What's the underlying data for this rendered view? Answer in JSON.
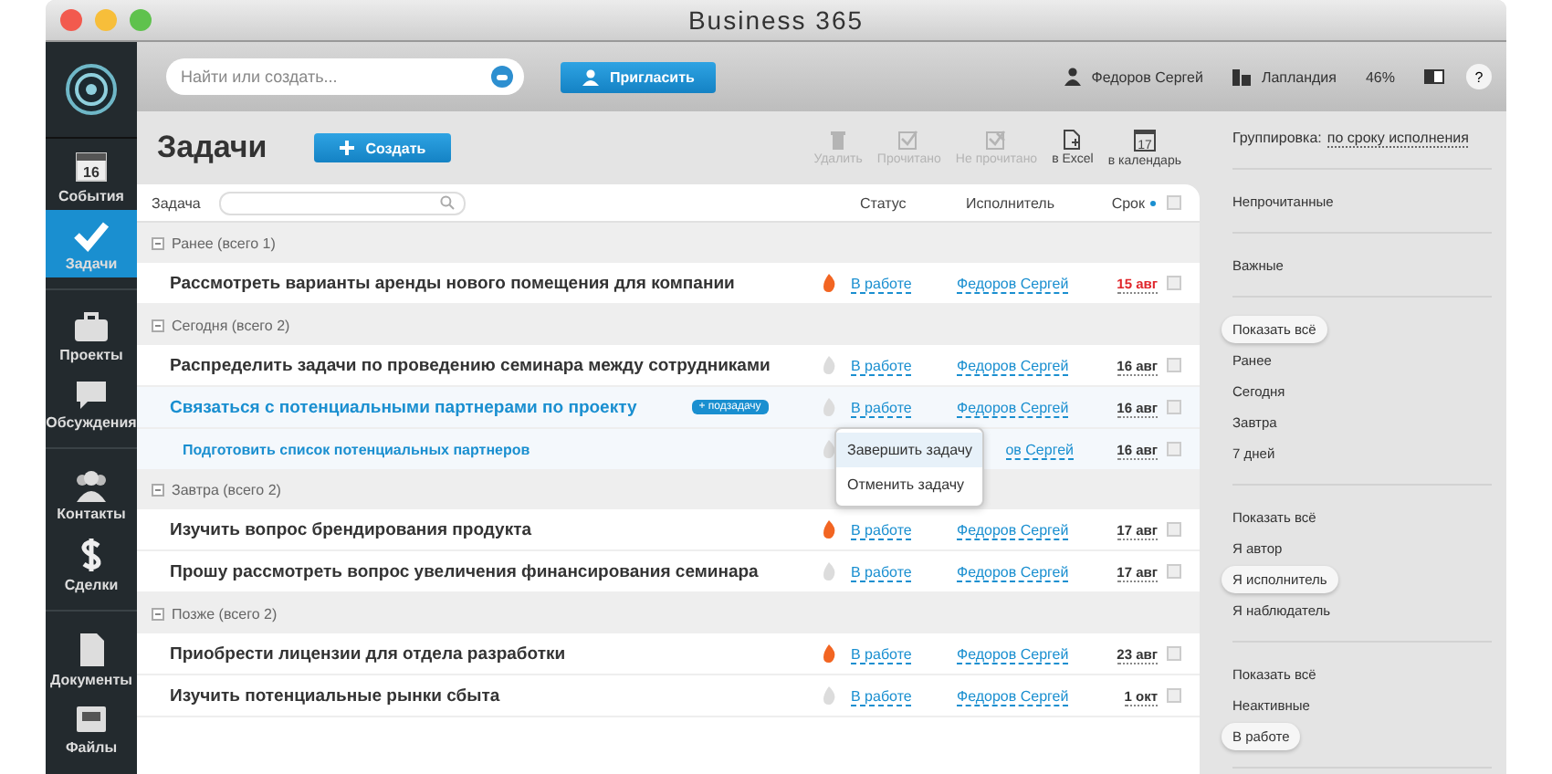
{
  "window": {
    "title": "Business 365"
  },
  "topbar": {
    "search": {
      "placeholder": "Найти или создать..."
    },
    "invite_button": "Пригласить",
    "user": "Федоров Сергей",
    "company": "Лапландия",
    "storage": "46%",
    "help": "?"
  },
  "sidebar": {
    "items": [
      {
        "label": "События",
        "badge": "16",
        "selected": false
      },
      {
        "label": "Задачи",
        "selected": true
      },
      {
        "label": "Проекты",
        "selected": false
      },
      {
        "label": "Обсуждения",
        "selected": false
      },
      {
        "label": "Контакты",
        "selected": false
      },
      {
        "label": "Сделки",
        "selected": false
      },
      {
        "label": "Документы",
        "selected": false
      },
      {
        "label": "Файлы",
        "selected": false
      }
    ]
  },
  "page": {
    "title": "Задачи",
    "create_button": "Создать",
    "toolbar": [
      {
        "label": "Удалить",
        "disabled": true
      },
      {
        "label": "Прочитано",
        "disabled": true
      },
      {
        "label": "Не прочитано",
        "disabled": true
      },
      {
        "label": "в Excel",
        "disabled": false
      },
      {
        "label": "в календарь",
        "badge": "17",
        "disabled": false
      }
    ]
  },
  "table": {
    "columns": [
      "Задача",
      "Статус",
      "Исполнитель",
      "Срок"
    ],
    "select_all_checked": false,
    "groups": [
      {
        "title": "Ранее (всего 1)",
        "expanded": true,
        "rows": [
          {
            "kind": "task",
            "title": "Рассмотреть варианты аренды нового помещения для компании",
            "hot": true,
            "status": "В работе",
            "assignee": "Федоров Сергей",
            "due": "15 авг",
            "overdue": true,
            "checked": false
          }
        ]
      },
      {
        "title": "Сегодня (всего 2)",
        "expanded": true,
        "rows": [
          {
            "kind": "task",
            "title": "Распределить задачи по проведению семинара между сотрудниками",
            "hot": false,
            "status": "В работе",
            "assignee": "Федоров Сергей",
            "due": "16 авг",
            "overdue": false,
            "checked": false
          },
          {
            "kind": "parent",
            "title": "Связаться с потенциальными партнерами по проекту",
            "badge": "+ подзадачу",
            "hot": false,
            "status": "В работе",
            "assignee": "Федоров Сергей",
            "due": "16 авг",
            "overdue": false,
            "checked": false
          },
          {
            "kind": "subtask",
            "title": "Подготовить список потенциальных партнеров",
            "hot": false,
            "assignee": "ов Сергей",
            "due": "16 авг",
            "overdue": false,
            "checked": false
          }
        ]
      },
      {
        "title": "Завтра (всего 2)",
        "expanded": true,
        "rows": [
          {
            "kind": "task",
            "title": "Изучить вопрос брендирования продукта",
            "hot": true,
            "status": "В работе",
            "assignee": "Федоров Сергей",
            "due": "17 авг",
            "overdue": false,
            "checked": false
          },
          {
            "kind": "task",
            "title": "Прошу рассмотреть вопрос увеличения финансирования семинара",
            "hot": false,
            "status": "В работе",
            "assignee": "Федоров Сергей",
            "due": "17 авг",
            "overdue": false,
            "checked": false
          }
        ]
      },
      {
        "title": "Позже (всего 2)",
        "expanded": true,
        "rows": [
          {
            "kind": "task",
            "title": "Приобрести лицензии для отдела разработки",
            "hot": true,
            "status": "В работе",
            "assignee": "Федоров Сергей",
            "due": "23 авг",
            "overdue": false,
            "checked": false
          },
          {
            "kind": "task",
            "title": "Изучить потенциальные рынки сбыта",
            "hot": false,
            "status": "В работе",
            "assignee": "Федоров Сергей",
            "due": "1 окт",
            "overdue": false,
            "checked": false
          }
        ]
      }
    ]
  },
  "status_menu": {
    "items": [
      {
        "label": "Завершить задачу",
        "selected": true
      },
      {
        "label": "Отменить задачу",
        "selected": false
      }
    ]
  },
  "filters": {
    "grouping_label": "Группировка:",
    "grouping_value": "по сроку исполнения",
    "sections": [
      {
        "items": [
          {
            "label": "Непрочитанные",
            "selected": false
          }
        ]
      },
      {
        "items": [
          {
            "label": "Важные",
            "selected": false
          }
        ]
      },
      {
        "items": [
          {
            "label": "Показать всё",
            "selected": true
          },
          {
            "label": "Ранее",
            "selected": false
          },
          {
            "label": "Сегодня",
            "selected": false
          },
          {
            "label": "Завтра",
            "selected": false
          },
          {
            "label": "7 дней",
            "selected": false
          }
        ]
      },
      {
        "items": [
          {
            "label": "Показать всё",
            "selected": false
          },
          {
            "label": "Я автор",
            "selected": false
          },
          {
            "label": "Я исполнитель",
            "selected": true
          },
          {
            "label": "Я наблюдатель",
            "selected": false
          }
        ]
      },
      {
        "items": [
          {
            "label": "Показать всё",
            "selected": false
          },
          {
            "label": "Неактивные",
            "selected": false
          },
          {
            "label": "В работе",
            "selected": true
          }
        ]
      }
    ]
  }
}
